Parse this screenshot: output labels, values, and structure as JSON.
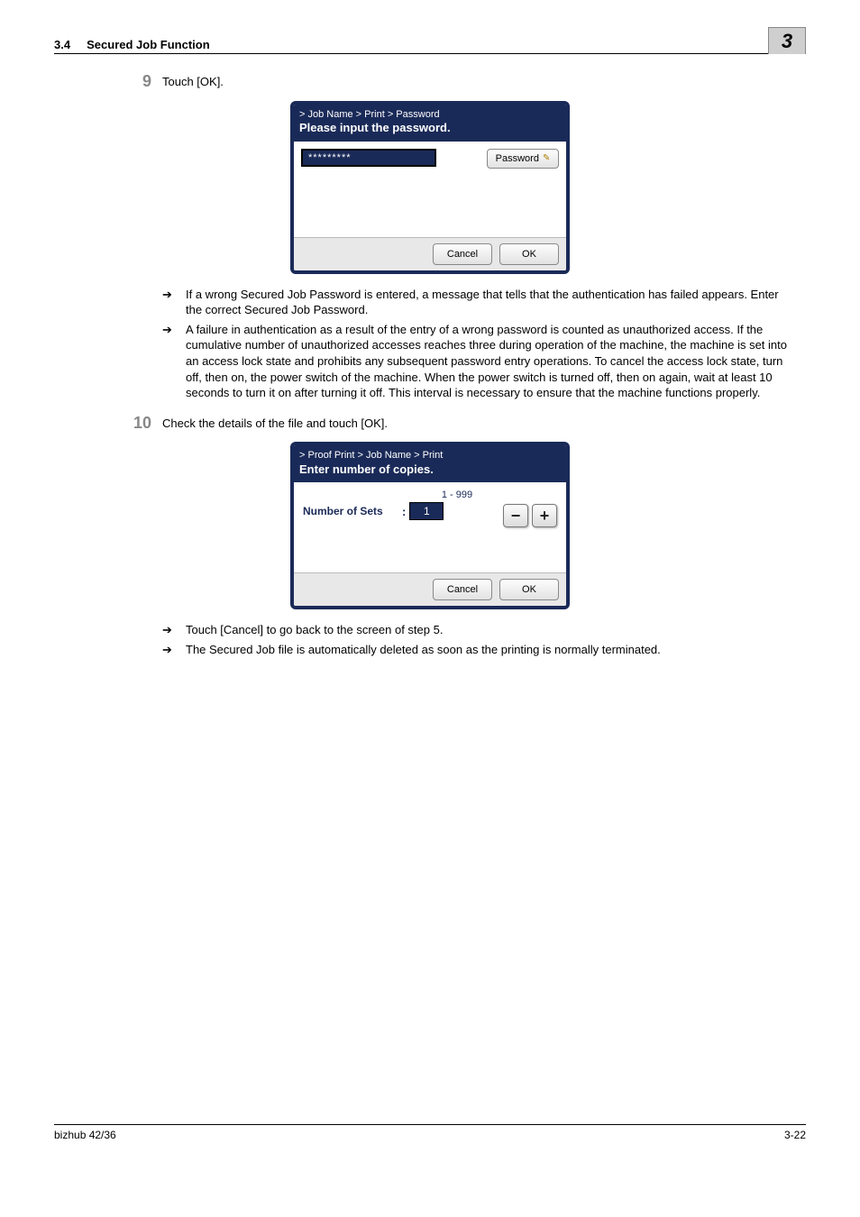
{
  "header": {
    "section_num": "3.4",
    "section_title": "Secured Job Function",
    "chapter": "3"
  },
  "step9": {
    "num": "9",
    "text": "Touch [OK]."
  },
  "dialog1": {
    "crumb": "> Job Name > Print > Password",
    "prompt": "Please input the password.",
    "field_value": "*********",
    "password_btn": "Password",
    "cancel": "Cancel",
    "ok": "OK"
  },
  "bullets1": [
    "If a wrong Secured Job Password is entered, a message that tells that the authentication has failed appears. Enter the correct Secured Job Password.",
    "A failure in authentication as a result of the entry of a wrong password is counted as unauthorized access. If the cumulative number of unauthorized accesses reaches three during operation of the machine, the machine is set into an access lock state and prohibits any subsequent password entry operations. To cancel the access lock state, turn off, then on, the power switch of the machine. When the power switch is turned off, then on again, wait at least 10 seconds to turn it on after turning it off. This interval is necessary to ensure that the machine functions properly."
  ],
  "step10": {
    "num": "10",
    "text": "Check the details of the file and touch [OK]."
  },
  "dialog2": {
    "crumb": "> Proof Print > Job Name > Print",
    "prompt": "Enter number of copies.",
    "range": "1 - 999",
    "sets_label": "Number of Sets",
    "value": "1",
    "minus": "−",
    "plus": "+",
    "cancel": "Cancel",
    "ok": "OK"
  },
  "bullets2": [
    "Touch [Cancel] to go back to the screen of step 5.",
    "The Secured Job file is automatically deleted as soon as the printing is normally terminated."
  ],
  "footer": {
    "model": "bizhub 42/36",
    "page": "3-22"
  },
  "arrow_glyph": "➔"
}
